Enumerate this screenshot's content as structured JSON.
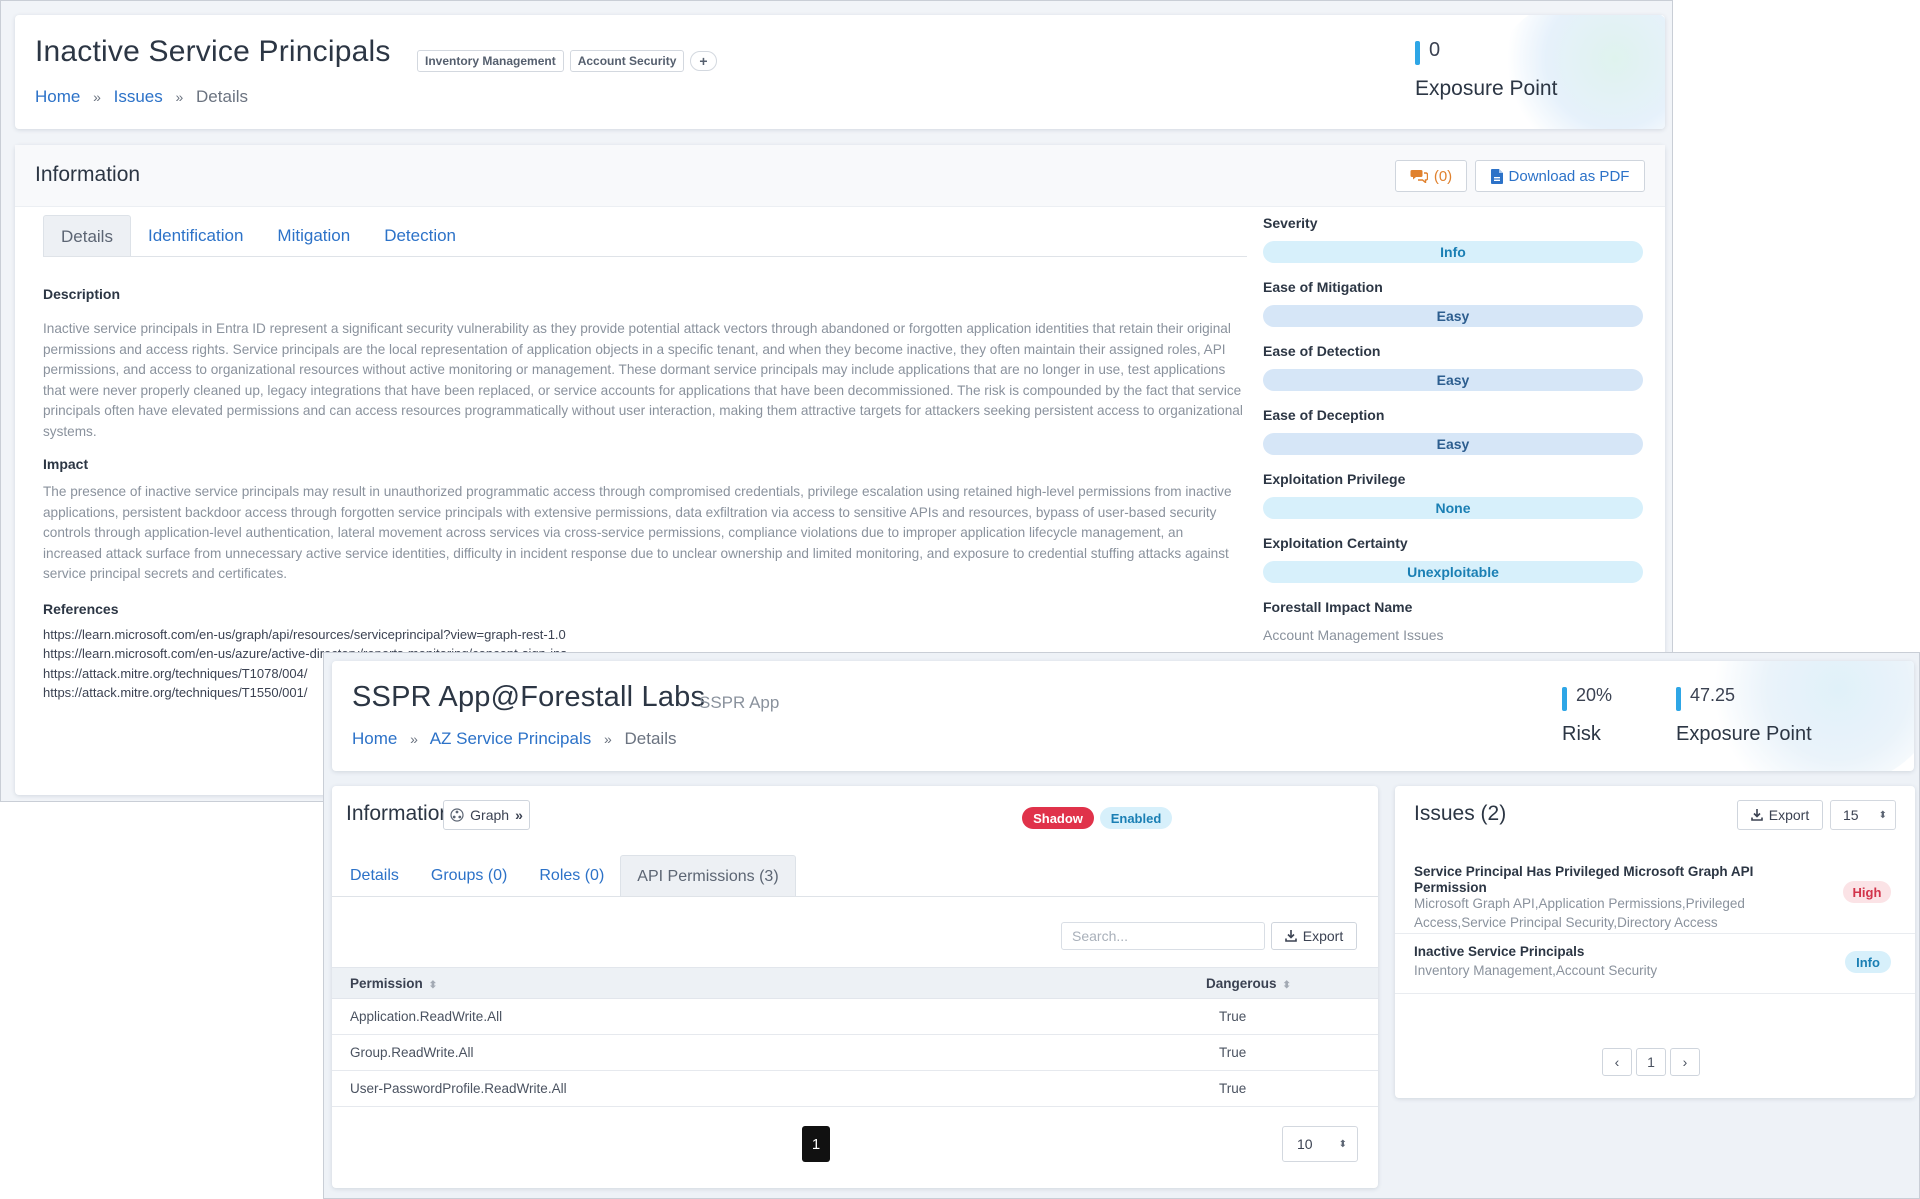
{
  "issue_page": {
    "title": "Inactive Service Principals",
    "tags": [
      "Inventory Management",
      "Account Security"
    ],
    "add_tag": "+",
    "breadcrumb": {
      "home": "Home",
      "issues": "Issues",
      "current": "Details",
      "sep": "»"
    },
    "exposure": {
      "value": "0",
      "label": "Exposure Point"
    },
    "info": {
      "title": "Information",
      "comments": "(0)",
      "download": "Download as PDF",
      "tabs": [
        "Details",
        "Identification",
        "Mitigation",
        "Detection"
      ],
      "description_label": "Description",
      "description": "Inactive service principals in Entra ID represent a significant security vulnerability as they provide potential attack vectors through abandoned or forgotten application identities that retain their original permissions and access rights. Service principals are the local representation of application objects in a specific tenant, and when they become inactive, they often maintain their assigned roles, API permissions, and access to organizational resources without active monitoring or management. These dormant service principals may include applications that are no longer in use, test applications that were never properly cleaned up, legacy integrations that have been replaced, or service accounts for applications that have been decommissioned. The risk is compounded by the fact that service principals often have elevated permissions and can access resources programmatically without user interaction, making them attractive targets for attackers seeking persistent access to organizational systems.",
      "impact_label": "Impact",
      "impact": "The presence of inactive service principals may result in unauthorized programmatic access through compromised credentials, privilege escalation using retained high-level permissions from inactive applications, persistent backdoor access through forgotten service principals with extensive permissions, data exfiltration via access to sensitive APIs and resources, bypass of user-based security controls through application-level authentication, lateral movement across services via cross-service permissions, compliance violations due to improper application lifecycle management, an increased attack surface from unnecessary active service identities, difficulty in incident response due to unclear ownership and limited monitoring, and exposure to credential stuffing attacks against service principal secrets and certificates.",
      "references_label": "References",
      "references": [
        "https://learn.microsoft.com/en-us/graph/api/resources/serviceprincipal?view=graph-rest-1.0",
        "https://learn.microsoft.com/en-us/azure/active-directory/reports-monitoring/concept-sign-ins",
        "https://attack.mitre.org/techniques/T1078/004/",
        "https://attack.mitre.org/techniques/T1550/001/"
      ],
      "meta": [
        {
          "label": "Severity",
          "value": "Info"
        },
        {
          "label": "Ease of Mitigation",
          "value": "Easy"
        },
        {
          "label": "Ease of Detection",
          "value": "Easy"
        },
        {
          "label": "Ease of Deception",
          "value": "Easy"
        },
        {
          "label": "Exploitation Privilege",
          "value": "None"
        },
        {
          "label": "Exploitation Certainty",
          "value": "Unexploitable"
        }
      ],
      "impact_name_label": "Forestall Impact Name",
      "impact_name": "Account Management Issues"
    }
  },
  "sp_page": {
    "title": "SSPR App@Forestall Labs",
    "subtitle": "SSPR App",
    "breadcrumb": {
      "home": "Home",
      "section": "AZ Service Principals",
      "current": "Details",
      "sep": "»"
    },
    "risk": {
      "value": "20%",
      "label": "Risk"
    },
    "exposure": {
      "value": "47.25",
      "label": "Exposure Point"
    },
    "info": {
      "title": "Information",
      "graph_button": "Graph",
      "badges": [
        "Shadow",
        "Enabled"
      ],
      "tabs": [
        "Details",
        "Groups (0)",
        "Roles (0)",
        "API Permissions (3)"
      ],
      "search_placeholder": "Search...",
      "export": "Export",
      "columns": [
        "Permission",
        "Dangerous"
      ],
      "rows": [
        [
          "Application.ReadWrite.All",
          "True"
        ],
        [
          "Group.ReadWrite.All",
          "True"
        ],
        [
          "User-PasswordProfile.ReadWrite.All",
          "True"
        ]
      ],
      "page": "1",
      "page_size": "10"
    },
    "issues": {
      "title": "Issues (2)",
      "export": "Export",
      "page_size": "15",
      "items": [
        {
          "title": "Service Principal Has Privileged Microsoft Graph API Permission",
          "tags": "Microsoft Graph API,Application Permissions,Privileged Access,Service Principal Security,Directory Access",
          "severity": "High"
        },
        {
          "title": "Inactive Service Principals",
          "tags": "Inventory Management,Account Security",
          "severity": "Info"
        }
      ],
      "page": "1",
      "prev": "‹",
      "next": "›"
    }
  },
  "colors": {
    "link": "#2c72c8",
    "accent_bar": "#2ea6e6",
    "shadow_badge": "#e0324a",
    "high_badge_bg": "#fbe3e6",
    "info_badge_bg": "#d7f0fb"
  }
}
